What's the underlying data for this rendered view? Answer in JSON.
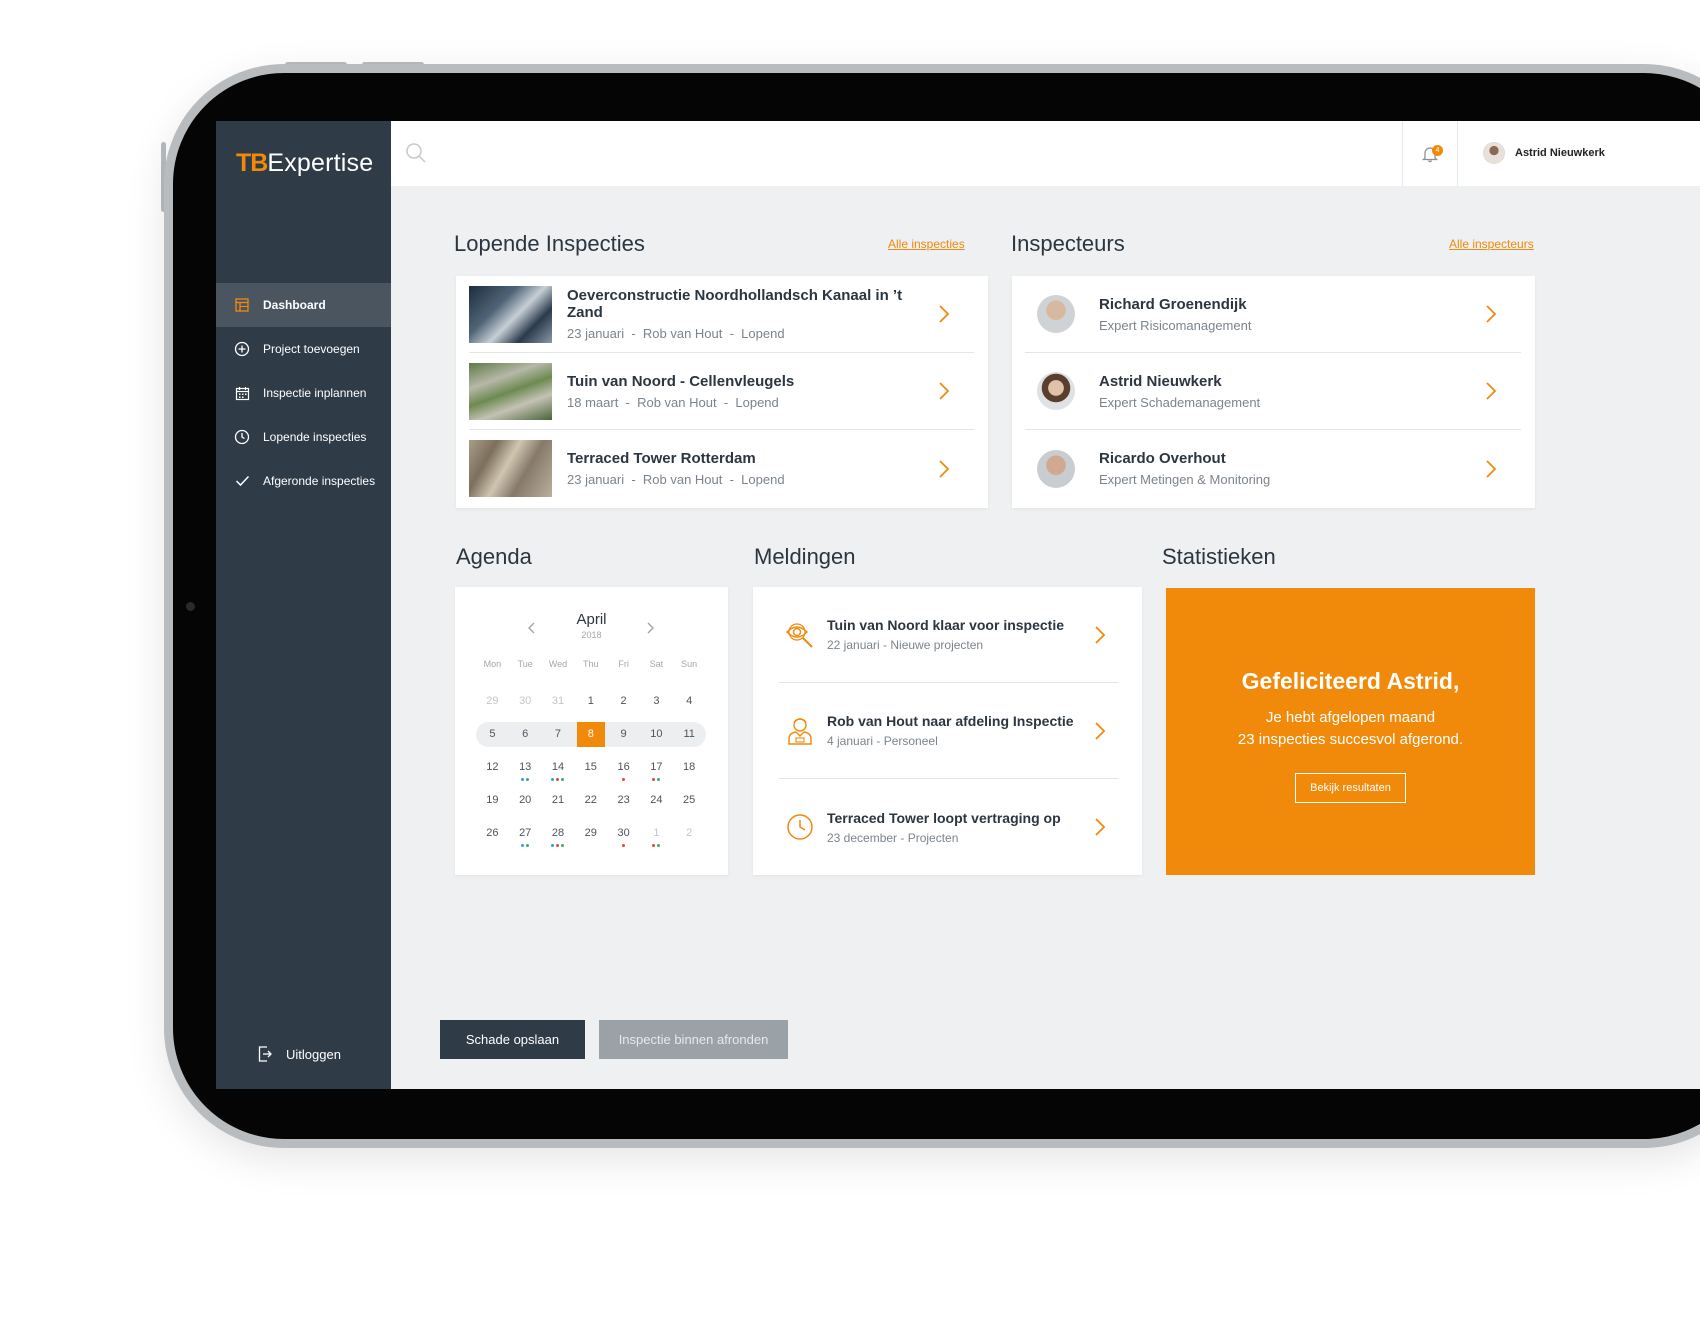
{
  "app": {
    "logo_prefix": "TB",
    "logo_suffix": "Expertise"
  },
  "sidebar": {
    "items": [
      {
        "label": "Dashboard",
        "icon": "dashboard-icon",
        "active": true
      },
      {
        "label": "Project toevoegen",
        "icon": "plus-circle-icon"
      },
      {
        "label": "Inspectie inplannen",
        "icon": "calendar-icon"
      },
      {
        "label": "Lopende inspecties",
        "icon": "clock-icon"
      },
      {
        "label": "Afgeronde inspecties",
        "icon": "check-icon"
      }
    ],
    "logout_label": "Uitloggen"
  },
  "topbar": {
    "search_placeholder": "",
    "notification_count": "4",
    "user_name": "Astrid Nieuwkerk"
  },
  "inspecties": {
    "title": "Lopende Inspecties",
    "link": "Alle inspecties",
    "items": [
      {
        "title": "Oeverconstructie Noordhollandsch Kanaal in ’t Zand",
        "date": "23 januari",
        "person": "Rob van Hout",
        "status": "Lopend"
      },
      {
        "title": "Tuin van Noord - Cellenvleugels",
        "date": "18 maart",
        "person": "Rob van Hout",
        "status": "Lopend"
      },
      {
        "title": "Terraced Tower Rotterdam",
        "date": "23 januari",
        "person": "Rob van Hout",
        "status": "Lopend"
      }
    ]
  },
  "inspecteurs": {
    "title": "Inspecteurs",
    "link": "Alle inspecteurs",
    "items": [
      {
        "name": "Richard Groenendijk",
        "role": "Expert Risicomanagement"
      },
      {
        "name": "Astrid Nieuwkerk",
        "role": "Expert Schademanagement"
      },
      {
        "name": "Ricardo Overhout",
        "role": "Expert Metingen & Monitoring"
      }
    ]
  },
  "agenda": {
    "title": "Agenda",
    "month": "April",
    "year": "2018",
    "weekdays": [
      "Mon",
      "Tue",
      "Wed",
      "Thu",
      "Fri",
      "Sat",
      "Sun"
    ],
    "weeks": [
      [
        "29",
        "30",
        "31",
        "1",
        "2",
        "3",
        "4"
      ],
      [
        "5",
        "6",
        "7",
        "8",
        "9",
        "10",
        "11"
      ],
      [
        "12",
        "13",
        "14",
        "15",
        "16",
        "17",
        "18"
      ],
      [
        "19",
        "20",
        "21",
        "22",
        "23",
        "24",
        "25"
      ],
      [
        "26",
        "27",
        "28",
        "29",
        "30",
        "1",
        "2"
      ]
    ],
    "selected": "8"
  },
  "meldingen": {
    "title": "Meldingen",
    "items": [
      {
        "title": "Tuin van Noord klaar voor inspectie",
        "sub": "22 januari - Nieuwe projecten",
        "icon": "inspect-eye-icon"
      },
      {
        "title": "Rob van Hout naar afdeling Inspectie",
        "sub": "4 januari - Personeel",
        "icon": "person-icon"
      },
      {
        "title": "Terraced Tower loopt vertraging op",
        "sub": "23 december - Projecten",
        "icon": "clock-icon"
      }
    ]
  },
  "statistieken": {
    "title": "Statistieken",
    "headline": "Gefeliciteerd Astrid,",
    "line1": "Je hebt afgelopen maand",
    "line2": "23 inspecties succesvol afgerond.",
    "button": "Bekijk resultaten"
  },
  "actions": {
    "primary": "Schade opslaan",
    "secondary": "Inspectie binnen afronden"
  },
  "colors": {
    "accent": "#f18a0b",
    "sidebar": "#2f3b47",
    "background": "#eff0f1"
  }
}
